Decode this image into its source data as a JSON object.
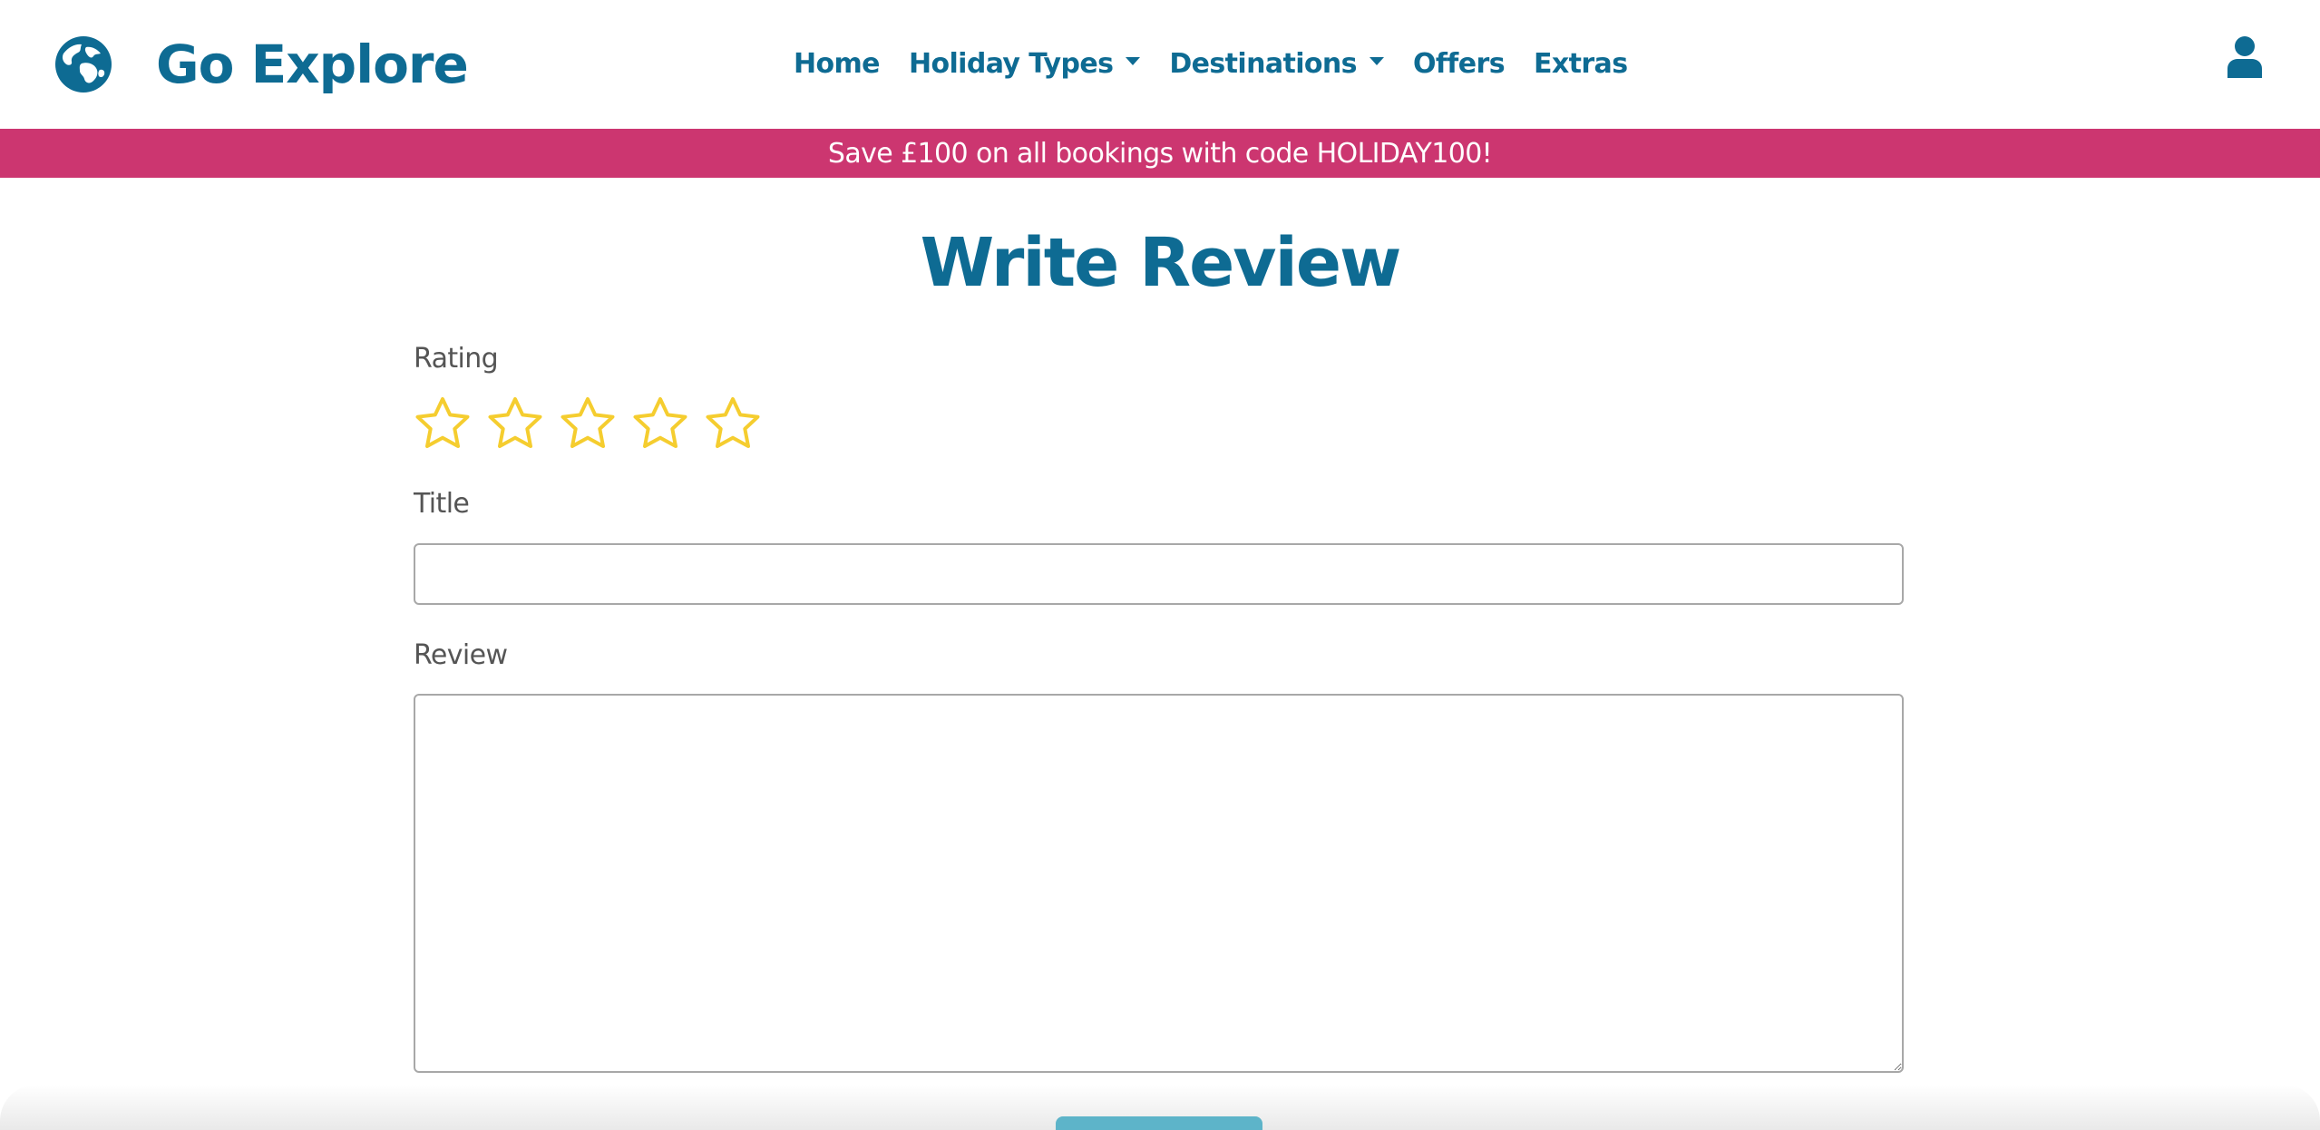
{
  "header": {
    "brand": {
      "name": "Go Explore",
      "icon": "globe-icon"
    },
    "nav": [
      {
        "label": "Home",
        "dropdown": false
      },
      {
        "label": "Holiday Types",
        "dropdown": true
      },
      {
        "label": "Destinations",
        "dropdown": true
      },
      {
        "label": "Offers",
        "dropdown": false
      },
      {
        "label": "Extras",
        "dropdown": false
      }
    ],
    "account_icon": "user-icon"
  },
  "promo": {
    "text": "Save £100 on all bookings with code HOLIDAY100!"
  },
  "main": {
    "title": "Write Review",
    "form": {
      "rating_label": "Rating",
      "rating": {
        "value": 0,
        "max": 5,
        "icon": "star-outline-icon"
      },
      "title_label": "Title",
      "title_value": "",
      "review_label": "Review",
      "review_value": ""
    }
  },
  "colors": {
    "brand": "#0e6b93",
    "promo_bg": "#cc3670",
    "star": "#f5cd2f",
    "label_text": "#555555",
    "input_border": "#a8a8a8",
    "submit_button": "#5db4c9"
  }
}
